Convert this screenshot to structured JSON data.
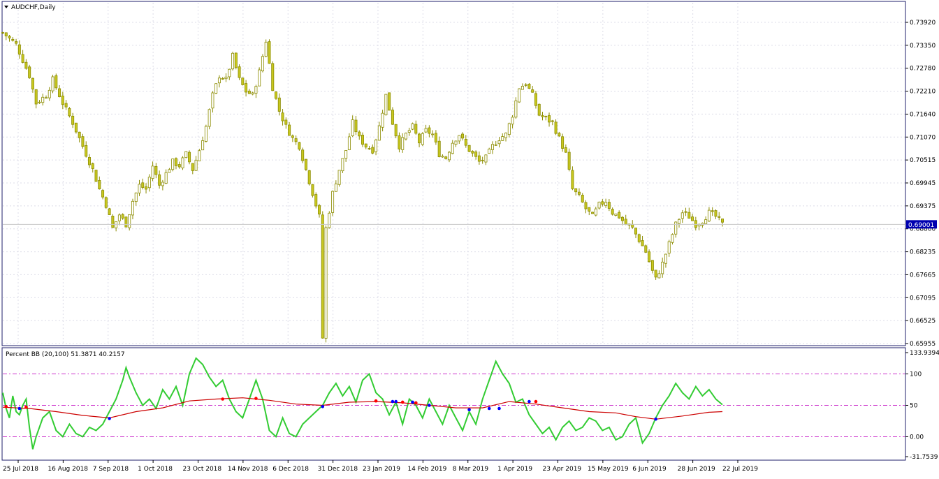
{
  "window": {
    "title": "AUDCHF,Daily",
    "menu_icon": "triangle-down-icon"
  },
  "indicator": {
    "title": "Percent BB (20,100) 51.3871 40.2157"
  },
  "colors": {
    "background": "#ffffff",
    "frame": "#1f1f6b",
    "grid": "#dcdce8",
    "candle": "#8c8c00",
    "candle_fill": "#c8c820",
    "price_label_bg": "#0000b0",
    "percent_line": "#33cc33",
    "ma_line": "#cc0000",
    "level_line": "#cc33cc",
    "dot_red": "#ff0000",
    "dot_blue": "#0000ff"
  },
  "chart_data": [
    {
      "type": "candlestick",
      "symbol": "AUDCHF",
      "timeframe": "Daily",
      "y_axis_ticks": [
        "0.73920",
        "0.73350",
        "0.72780",
        "0.72210",
        "0.71640",
        "0.71070",
        "0.70515",
        "0.69945",
        "0.69375",
        "0.68800",
        "0.68235",
        "0.67665",
        "0.67095",
        "0.66525",
        "0.65955"
      ],
      "ylim": [
        0.65955,
        0.742
      ],
      "current_price": "0.69001",
      "x_axis_ticks": [
        "25 Jul 2018",
        "16 Aug 2018",
        "7 Sep 2018",
        "1 Oct 2018",
        "23 Oct 2018",
        "14 Nov 2018",
        "6 Dec 2018",
        "31 Dec 2018",
        "23 Jan 2019",
        "14 Feb 2019",
        "8 Mar 2019",
        "1 Apr 2019",
        "23 Apr 2019",
        "15 May 2019",
        "6 Jun 2019",
        "28 Jun 2019",
        "22 Jul 2019"
      ],
      "close_path": [
        [
          0,
          0.739
        ],
        [
          4,
          0.736
        ],
        [
          8,
          0.728
        ],
        [
          10,
          0.721
        ],
        [
          13,
          0.723
        ],
        [
          15,
          0.727
        ],
        [
          18,
          0.721
        ],
        [
          21,
          0.716
        ],
        [
          24,
          0.71
        ],
        [
          27,
          0.704
        ],
        [
          29,
          0.699
        ],
        [
          31,
          0.695
        ],
        [
          33,
          0.689
        ],
        [
          35,
          0.6925
        ],
        [
          37,
          0.69
        ],
        [
          39,
          0.696
        ],
        [
          41,
          0.7
        ],
        [
          43,
          0.699
        ],
        [
          45,
          0.705
        ],
        [
          47,
          0.7
        ],
        [
          49,
          0.703
        ],
        [
          51,
          0.706
        ],
        [
          53,
          0.705
        ],
        [
          55,
          0.708
        ],
        [
          57,
          0.704
        ],
        [
          59,
          0.709
        ],
        [
          61,
          0.715
        ],
        [
          63,
          0.723
        ],
        [
          65,
          0.728
        ],
        [
          67,
          0.727
        ],
        [
          69,
          0.733
        ],
        [
          71,
          0.727
        ],
        [
          73,
          0.724
        ],
        [
          75,
          0.723
        ],
        [
          77,
          0.729
        ],
        [
          79,
          0.737
        ],
        [
          81,
          0.725
        ],
        [
          83,
          0.719
        ],
        [
          85,
          0.715
        ],
        [
          87,
          0.712
        ],
        [
          89,
          0.71
        ],
        [
          91,
          0.704
        ],
        [
          93,
          0.698
        ],
        [
          95,
          0.692
        ],
        [
          96,
          0.661
        ],
        [
          97,
          0.689
        ],
        [
          99,
          0.698
        ],
        [
          101,
          0.704
        ],
        [
          103,
          0.709
        ],
        [
          105,
          0.716
        ],
        [
          107,
          0.712
        ],
        [
          109,
          0.71
        ],
        [
          111,
          0.709
        ],
        [
          113,
          0.715
        ],
        [
          115,
          0.723
        ],
        [
          117,
          0.716
        ],
        [
          119,
          0.71
        ],
        [
          121,
          0.713
        ],
        [
          123,
          0.715
        ],
        [
          125,
          0.711
        ],
        [
          127,
          0.714
        ],
        [
          129,
          0.713
        ],
        [
          131,
          0.708
        ],
        [
          133,
          0.707
        ],
        [
          135,
          0.711
        ],
        [
          137,
          0.713
        ],
        [
          139,
          0.71
        ],
        [
          141,
          0.708
        ],
        [
          143,
          0.706
        ],
        [
          145,
          0.707
        ],
        [
          147,
          0.71
        ],
        [
          149,
          0.712
        ],
        [
          151,
          0.713
        ],
        [
          153,
          0.718
        ],
        [
          155,
          0.725
        ],
        [
          157,
          0.726
        ],
        [
          159,
          0.723
        ],
        [
          161,
          0.718
        ],
        [
          163,
          0.717
        ],
        [
          165,
          0.716
        ],
        [
          167,
          0.712
        ],
        [
          169,
          0.708
        ],
        [
          171,
          0.699
        ],
        [
          173,
          0.697
        ],
        [
          175,
          0.694
        ],
        [
          177,
          0.692
        ],
        [
          179,
          0.695
        ],
        [
          181,
          0.696
        ],
        [
          183,
          0.693
        ],
        [
          185,
          0.692
        ],
        [
          187,
          0.69
        ],
        [
          189,
          0.689
        ],
        [
          191,
          0.686
        ],
        [
          193,
          0.683
        ],
        [
          195,
          0.678
        ],
        [
          196,
          0.676
        ],
        [
          198,
          0.68
        ],
        [
          200,
          0.685
        ],
        [
          202,
          0.69
        ],
        [
          204,
          0.693
        ],
        [
          206,
          0.692
        ],
        [
          208,
          0.69
        ],
        [
          210,
          0.691
        ],
        [
          212,
          0.693
        ],
        [
          214,
          0.692
        ],
        [
          216,
          0.69
        ]
      ]
    },
    {
      "type": "line",
      "title": "Percent BB (20,100) 51.3871 40.2157",
      "y_axis_ticks": [
        "133.9394",
        "100",
        "50",
        "0.00",
        "-31.7539"
      ],
      "ylim": [
        -31.7539,
        133.9394
      ],
      "levels": [
        100,
        50,
        0
      ],
      "series": [
        {
          "name": "Percent BB",
          "points": [
            [
              0,
              70
            ],
            [
              1,
              45
            ],
            [
              2,
              30
            ],
            [
              3,
              65
            ],
            [
              4,
              40
            ],
            [
              5,
              35
            ],
            [
              6,
              50
            ],
            [
              7,
              60
            ],
            [
              8,
              15
            ],
            [
              9,
              -20
            ],
            [
              10,
              0
            ],
            [
              12,
              30
            ],
            [
              14,
              40
            ],
            [
              16,
              10
            ],
            [
              18,
              0
            ],
            [
              20,
              20
            ],
            [
              22,
              5
            ],
            [
              24,
              0
            ],
            [
              26,
              15
            ],
            [
              28,
              10
            ],
            [
              30,
              20
            ],
            [
              32,
              40
            ],
            [
              34,
              60
            ],
            [
              36,
              90
            ],
            [
              37,
              110
            ],
            [
              38,
              95
            ],
            [
              40,
              70
            ],
            [
              42,
              50
            ],
            [
              44,
              60
            ],
            [
              46,
              45
            ],
            [
              48,
              75
            ],
            [
              50,
              60
            ],
            [
              52,
              80
            ],
            [
              54,
              50
            ],
            [
              56,
              100
            ],
            [
              58,
              125
            ],
            [
              60,
              115
            ],
            [
              62,
              95
            ],
            [
              64,
              80
            ],
            [
              66,
              90
            ],
            [
              68,
              60
            ],
            [
              70,
              40
            ],
            [
              72,
              30
            ],
            [
              74,
              60
            ],
            [
              76,
              90
            ],
            [
              78,
              60
            ],
            [
              80,
              10
            ],
            [
              82,
              0
            ],
            [
              84,
              30
            ],
            [
              86,
              5
            ],
            [
              88,
              0
            ],
            [
              90,
              20
            ],
            [
              92,
              30
            ],
            [
              94,
              40
            ],
            [
              96,
              50
            ],
            [
              98,
              70
            ],
            [
              100,
              85
            ],
            [
              102,
              65
            ],
            [
              104,
              80
            ],
            [
              106,
              55
            ],
            [
              108,
              90
            ],
            [
              110,
              100
            ],
            [
              112,
              70
            ],
            [
              114,
              60
            ],
            [
              116,
              35
            ],
            [
              118,
              55
            ],
            [
              120,
              20
            ],
            [
              122,
              60
            ],
            [
              124,
              50
            ],
            [
              126,
              30
            ],
            [
              128,
              60
            ],
            [
              130,
              40
            ],
            [
              132,
              20
            ],
            [
              134,
              50
            ],
            [
              136,
              30
            ],
            [
              138,
              10
            ],
            [
              140,
              40
            ],
            [
              142,
              20
            ],
            [
              144,
              60
            ],
            [
              146,
              90
            ],
            [
              148,
              120
            ],
            [
              150,
              100
            ],
            [
              152,
              85
            ],
            [
              154,
              55
            ],
            [
              156,
              60
            ],
            [
              158,
              35
            ],
            [
              160,
              20
            ],
            [
              162,
              5
            ],
            [
              164,
              15
            ],
            [
              166,
              -5
            ],
            [
              168,
              15
            ],
            [
              170,
              25
            ],
            [
              172,
              10
            ],
            [
              174,
              15
            ],
            [
              176,
              30
            ],
            [
              178,
              25
            ],
            [
              180,
              10
            ],
            [
              182,
              15
            ],
            [
              184,
              -5
            ],
            [
              186,
              0
            ],
            [
              188,
              20
            ],
            [
              190,
              30
            ],
            [
              192,
              -10
            ],
            [
              194,
              5
            ],
            [
              196,
              30
            ],
            [
              198,
              50
            ],
            [
              200,
              65
            ],
            [
              202,
              85
            ],
            [
              204,
              70
            ],
            [
              206,
              60
            ],
            [
              208,
              80
            ],
            [
              210,
              65
            ],
            [
              212,
              75
            ],
            [
              214,
              60
            ],
            [
              216,
              51
            ]
          ]
        },
        {
          "name": "Signal",
          "points": [
            [
              0,
              47
            ],
            [
              8,
              45
            ],
            [
              16,
              40
            ],
            [
              24,
              34
            ],
            [
              32,
              30
            ],
            [
              40,
              40
            ],
            [
              48,
              46
            ],
            [
              56,
              57
            ],
            [
              64,
              60
            ],
            [
              72,
              62
            ],
            [
              80,
              58
            ],
            [
              88,
              52
            ],
            [
              96,
              50
            ],
            [
              104,
              55
            ],
            [
              112,
              56
            ],
            [
              120,
              54
            ],
            [
              128,
              50
            ],
            [
              136,
              46
            ],
            [
              144,
              46
            ],
            [
              152,
              56
            ],
            [
              160,
              52
            ],
            [
              168,
              46
            ],
            [
              176,
              40
            ],
            [
              184,
              38
            ],
            [
              190,
              32
            ],
            [
              196,
              28
            ],
            [
              204,
              33
            ],
            [
              212,
              39
            ],
            [
              216,
              40
            ]
          ]
        }
      ],
      "markers_red": [
        [
          1,
          48
        ],
        [
          7,
          47
        ],
        [
          66,
          60
        ],
        [
          76,
          61
        ],
        [
          112,
          57
        ],
        [
          120,
          55
        ],
        [
          124,
          54
        ],
        [
          160,
          56
        ]
      ],
      "markers_blue": [
        [
          5,
          45
        ],
        [
          32,
          29
        ],
        [
          96,
          48
        ],
        [
          117,
          56
        ],
        [
          118,
          56
        ],
        [
          123,
          55
        ],
        [
          128,
          50
        ],
        [
          140,
          43
        ],
        [
          146,
          45
        ],
        [
          149,
          45
        ],
        [
          158,
          56
        ],
        [
          196,
          28
        ]
      ]
    }
  ]
}
